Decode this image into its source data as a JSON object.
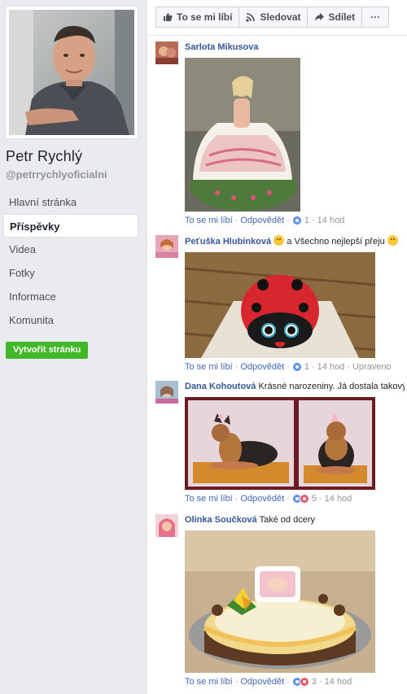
{
  "page": {
    "name": "Petr Rychlý",
    "handle": "@petrrychlyoficialni",
    "create_button": "Vytvořit stránku"
  },
  "nav": {
    "items": [
      {
        "label": "Hlavní stránka"
      },
      {
        "label": "Příspěvky",
        "active": true
      },
      {
        "label": "Videa"
      },
      {
        "label": "Fotky"
      },
      {
        "label": "Informace"
      },
      {
        "label": "Komunita"
      }
    ]
  },
  "actions": {
    "like": "To se mi líbí",
    "follow": "Sledovat",
    "share": "Sdílet",
    "more": "···"
  },
  "comments": [
    {
      "author": "Sarlota Mikusova",
      "text": "",
      "like_label": "To se mi líbí",
      "reply_label": "Odpovědět",
      "reactions": [
        "like"
      ],
      "count": "1",
      "time": "14 hod",
      "edited": ""
    },
    {
      "author": "Peťuška Hlubinková",
      "text": "a Všechno nejlepší přeju",
      "like_label": "To se mi líbí",
      "reply_label": "Odpovědět",
      "reactions": [
        "like"
      ],
      "count": "1",
      "time": "14 hod",
      "edited": "Upraveno"
    },
    {
      "author": "Dana Kohoutová",
      "text": "Krásné narozeniny. Já dostala takový .",
      "like_label": "To se mi líbí",
      "reply_label": "Odpovědět",
      "reactions": [
        "like",
        "love"
      ],
      "count": "5",
      "time": "14 hod",
      "edited": ""
    },
    {
      "author": "Olinka Součková",
      "text": "Také od dcery",
      "like_label": "To se mi líbí",
      "reply_label": "Odpovědět",
      "reactions": [
        "like",
        "love"
      ],
      "count": "3",
      "time": "14 hod",
      "edited": ""
    }
  ],
  "colors": {
    "link": "#365899",
    "accent_green": "#42b72a",
    "background": "#e9ebee"
  }
}
